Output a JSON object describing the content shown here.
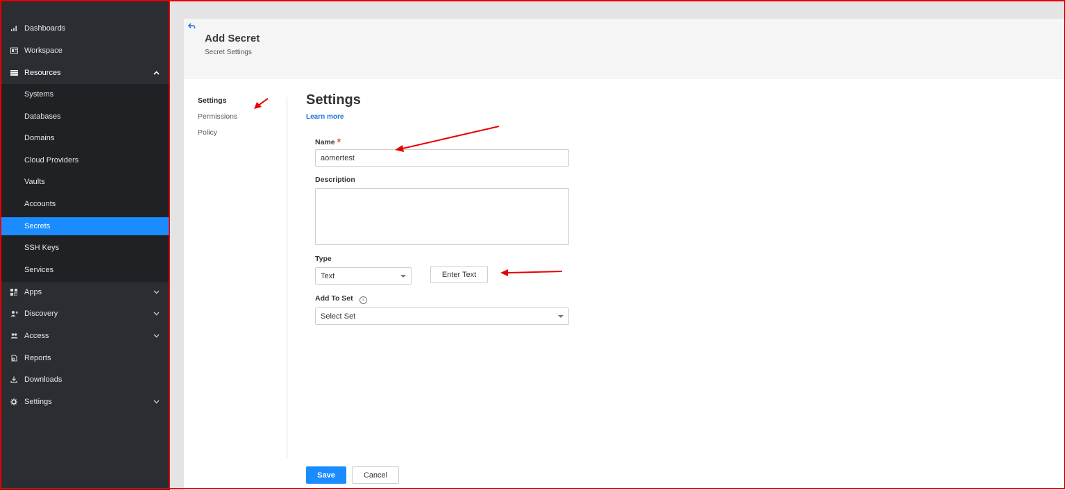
{
  "sidebar": {
    "items": [
      {
        "label": "Dashboards",
        "icon": "bar-chart-icon"
      },
      {
        "label": "Workspace",
        "icon": "workspace-icon"
      },
      {
        "label": "Resources",
        "icon": "list-icon",
        "expanded": true
      },
      {
        "label": "Apps",
        "icon": "apps-grid-icon"
      },
      {
        "label": "Discovery",
        "icon": "discovery-icon"
      },
      {
        "label": "Access",
        "icon": "users-icon"
      },
      {
        "label": "Reports",
        "icon": "report-icon"
      },
      {
        "label": "Downloads",
        "icon": "download-icon"
      },
      {
        "label": "Settings",
        "icon": "gear-icon"
      }
    ],
    "resources_children": [
      {
        "label": "Systems"
      },
      {
        "label": "Databases"
      },
      {
        "label": "Domains"
      },
      {
        "label": "Cloud Providers"
      },
      {
        "label": "Vaults"
      },
      {
        "label": "Accounts"
      },
      {
        "label": "Secrets",
        "active": true
      },
      {
        "label": "SSH Keys"
      },
      {
        "label": "Services"
      }
    ]
  },
  "header": {
    "title": "Add Secret",
    "subtitle": "Secret Settings"
  },
  "side_nav": {
    "items": [
      {
        "label": "Settings",
        "active": true
      },
      {
        "label": "Permissions"
      },
      {
        "label": "Policy"
      }
    ]
  },
  "form": {
    "section_title": "Settings",
    "learn_more": "Learn more",
    "name": {
      "label": "Name",
      "required_mark": "*",
      "value": "aomertest"
    },
    "description": {
      "label": "Description",
      "value": ""
    },
    "type": {
      "label": "Type",
      "value": "Text",
      "enter_text_button": "Enter Text"
    },
    "add_to_set": {
      "label": "Add To Set",
      "info_glyph": "i",
      "value": "Select Set"
    }
  },
  "footer": {
    "save_label": "Save",
    "cancel_label": "Cancel"
  },
  "colors": {
    "sidebar_bg": "#2a2d31",
    "submenu_bg": "#1f2124",
    "accent": "#1a8cff",
    "link": "#1a73d9",
    "annotation": "#e60000"
  }
}
